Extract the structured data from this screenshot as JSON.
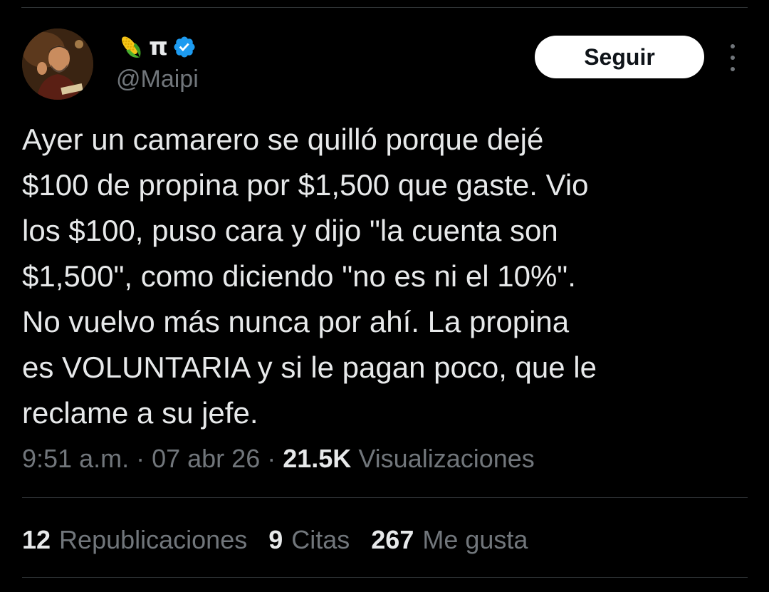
{
  "author": {
    "display_name": "π",
    "name_emoji": "corn-icon",
    "verified_icon": "verified-badge-icon",
    "handle": "@Maipi"
  },
  "follow_button": {
    "label": "Seguir"
  },
  "more_menu": {
    "icon": "more-vertical-icon"
  },
  "tweet": {
    "lines": [
      "Ayer un camarero se quilló porque dejé",
      "$100 de propina por $1,500 que gaste. Vio",
      "los $100, puso cara y dijo \"la cuenta son",
      "$1,500\", como diciendo \"no es ni el 10%\".",
      "No vuelvo más nunca por ahí. La propina",
      "es VOLUNTARIA y si le pagan poco, que le",
      "reclame a su jefe."
    ]
  },
  "meta": {
    "time": "9:51 a.m.",
    "separator": " · ",
    "date": "07 abr 26",
    "views_count": "21.5K",
    "views_label": "Visualizaciones"
  },
  "stats": {
    "reposts_count": "12",
    "reposts_label": "Republicaciones",
    "quotes_count": "9",
    "quotes_label": "Citas",
    "likes_count": "267",
    "likes_label": "Me gusta"
  },
  "colors": {
    "background": "#000000",
    "text_primary": "#e7e9ea",
    "text_secondary": "#71767b",
    "divider": "#2f3336",
    "verified_blue": "#1d9bf0",
    "follow_bg": "#ffffff"
  }
}
